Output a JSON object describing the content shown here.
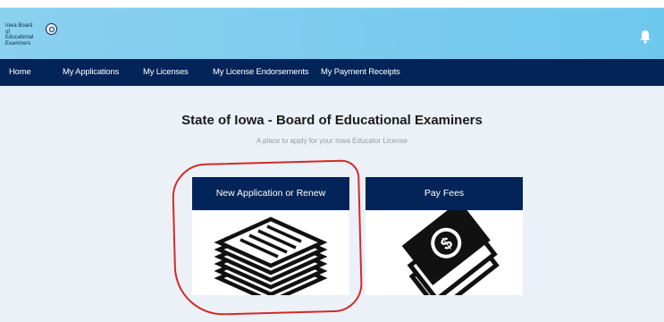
{
  "header": {
    "logo_text": "Iowa Board of Educational Examiners",
    "bell_icon": "bell-icon",
    "seal_icon": "state-seal-icon"
  },
  "nav": {
    "items": [
      {
        "label": "Home"
      },
      {
        "label": "My Applications"
      },
      {
        "label": "My Licenses"
      },
      {
        "label": "My License Endorsements"
      },
      {
        "label": "My Payment Receipts"
      }
    ]
  },
  "main": {
    "title": "State of Iowa - Board of Educational Examiners",
    "subtitle": "A place to apply for your Iowa Educator License"
  },
  "cards": [
    {
      "label": "New Application or Renew",
      "icon": "document-stack-icon"
    },
    {
      "label": "Pay Fees",
      "icon": "money-icon"
    }
  ],
  "colors": {
    "nav_bg": "#022459",
    "header_gradient": [
      "#8ad0ef",
      "#6ec8ee"
    ],
    "main_bg": "#ebf1f7",
    "highlight": "#d32a2a"
  }
}
